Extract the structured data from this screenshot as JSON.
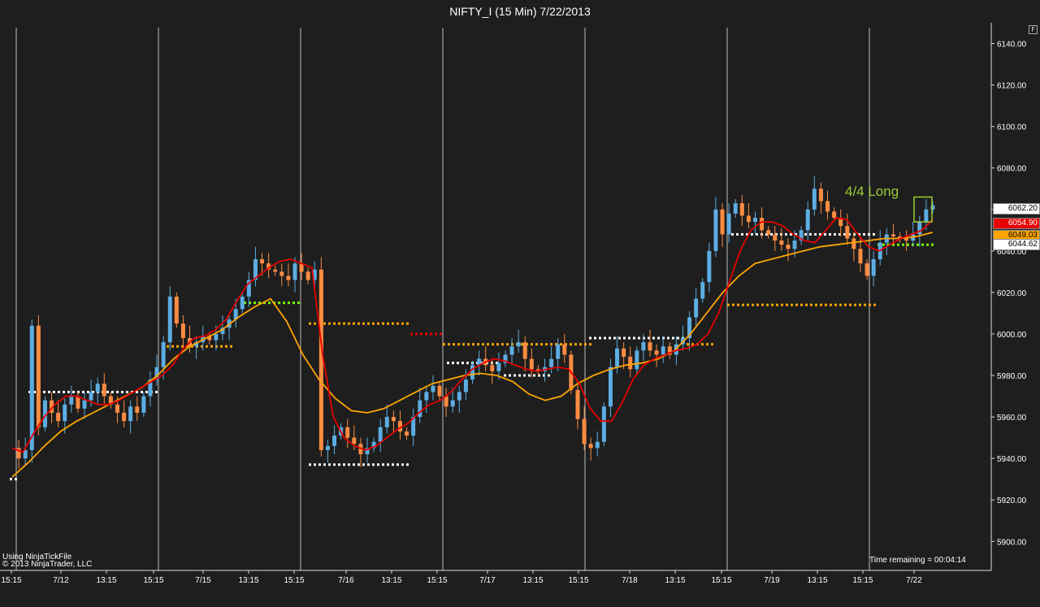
{
  "title": "NIFTY_I (15 Min)  7/22/2013",
  "f_button": "F",
  "footer": {
    "line1": "Using NinjaTickFile",
    "line2": "© 2013 NinjaTrader, LLC"
  },
  "time_remaining": "Time remaining = 00:04:14",
  "annotation": "4/4 Long",
  "price_tags": [
    {
      "label": "6062.20",
      "bg": "#ffffff",
      "fg": "#000000"
    },
    {
      "label": "6054.90",
      "bg": "#e60000",
      "fg": "#ffffff"
    },
    {
      "label": "6049.03",
      "bg": "#ffa500",
      "fg": "#000000"
    },
    {
      "label": "6044.62",
      "bg": "#ffffff",
      "fg": "#000000"
    }
  ],
  "colors": {
    "background": "#1e1e1e",
    "up_candle": "#5dade2",
    "down_candle": "#ff8c42",
    "fast_ma": "#e60000",
    "slow_ma": "#ffa500",
    "annotation": "#9acd32"
  },
  "chart_data": {
    "type": "candlestick",
    "ylim": [
      5886,
      6150
    ],
    "yticks": [
      "6140.00",
      "6120.00",
      "6100.00",
      "6080.00",
      "6060.00",
      "6040.00",
      "6020.00",
      "6000.00",
      "5980.00",
      "5960.00",
      "5940.00",
      "5920.00",
      "5900.00"
    ],
    "xticks": [
      "15:15",
      "7/12",
      "13:15",
      "15:15",
      "7/15",
      "13:15",
      "15:15",
      "7/16",
      "13:15",
      "15:15",
      "7/17",
      "13:15",
      "15:15",
      "7/18",
      "13:15",
      "15:15",
      "7/19",
      "13:15",
      "15:15",
      "7/22"
    ],
    "session_closes": 1,
    "close_path": [
      5945,
      5940,
      5944,
      6004,
      5955,
      5968,
      5962,
      5958,
      5966,
      5970,
      5964,
      5968,
      5972,
      5976,
      5970,
      5966,
      5962,
      5958,
      5965,
      5962,
      5970,
      5978,
      5984,
      5996,
      6018,
      6005,
      5998,
      5994,
      5996,
      5999,
      5997,
      6000,
      6003,
      6007,
      6012,
      6018,
      6026,
      6036,
      6034,
      6031,
      6030,
      6028,
      6026,
      6034,
      6030,
      6026,
      6031,
      5944,
      5946,
      5951,
      5955,
      5950,
      5947,
      5942,
      5945,
      5948,
      5955,
      5960,
      5958,
      5953,
      5951,
      5960,
      5968,
      5972,
      5975,
      5970,
      5965,
      5968,
      5972,
      5978,
      5985,
      5988,
      5985,
      5982,
      5986,
      5990,
      5994,
      5996,
      5988,
      5983,
      5982,
      5984,
      5988,
      5995,
      5990,
      5973,
      5959,
      5947,
      5945,
      5948,
      5965,
      5984,
      5993,
      5989,
      5983,
      5992,
      5996,
      5992,
      5990,
      5994,
      5990,
      5995,
      5998,
      6008,
      6017,
      6025,
      6040,
      6060,
      6048,
      6058,
      6063,
      6057,
      6054,
      6056,
      6050,
      6048,
      6045,
      6043,
      6041,
      6045,
      6050,
      6060,
      6070,
      6064,
      6059,
      6056,
      6052,
      6046,
      6041,
      6034,
      6028,
      6036,
      6044,
      6048,
      6047,
      6046,
      6045,
      6048,
      6054,
      6060,
      6062
    ],
    "fast_ma": [
      5945,
      5943,
      5952,
      5960,
      5966,
      5970,
      5970,
      5968,
      5966,
      5966,
      5968,
      5971,
      5974,
      5977,
      5980,
      5985,
      5993,
      5998,
      5999,
      6002,
      6007,
      6016,
      6024,
      6028,
      6032,
      6035,
      6036,
      6034,
      6032,
      5990,
      5960,
      5950,
      5946,
      5944,
      5946,
      5950,
      5954,
      5957,
      5962,
      5966,
      5968,
      5972,
      5978,
      5983,
      5986,
      5988,
      5987,
      5985,
      5983,
      5982,
      5983,
      5984,
      5983,
      5976,
      5964,
      5958,
      5958,
      5967,
      5978,
      5985,
      5988,
      5990,
      5992,
      5993,
      5995,
      6000,
      6010,
      6025,
      6040,
      6050,
      6054,
      6054,
      6052,
      6048,
      6045,
      6044,
      6050,
      6056,
      6055,
      6048,
      6042,
      6040,
      6043,
      6046,
      6048,
      6050,
      6055
    ],
    "slow_ma": [
      5931,
      5938,
      5946,
      5953,
      5958,
      5962,
      5966,
      5970,
      5974,
      5980,
      5988,
      5994,
      5998,
      6002,
      6008,
      6013,
      6017,
      6006,
      5990,
      5978,
      5969,
      5963,
      5962,
      5964,
      5968,
      5972,
      5976,
      5978,
      5980,
      5981,
      5980,
      5977,
      5971,
      5968,
      5970,
      5976,
      5980,
      5983,
      5985,
      5986,
      5988,
      5992,
      6000,
      6010,
      6020,
      6028,
      6034,
      6036,
      6038,
      6040,
      6042,
      6043,
      6044,
      6045,
      6046,
      6046,
      6047,
      6049
    ],
    "markers_note": "dotted support/resistance levels"
  }
}
